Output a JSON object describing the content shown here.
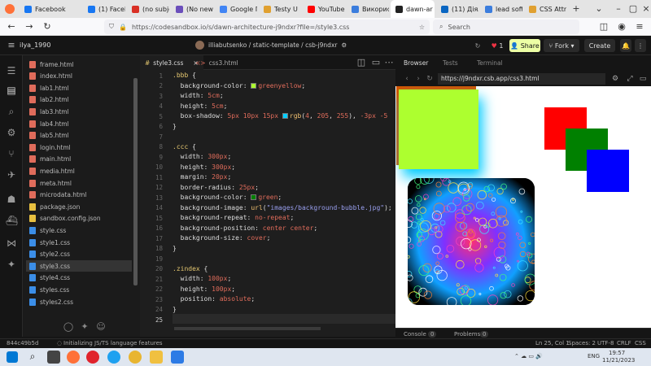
{
  "tabs": [
    {
      "label": "Facebook",
      "color": "#1877f2"
    },
    {
      "label": "(1) Facebo",
      "color": "#1877f2"
    },
    {
      "label": "(no subjec",
      "color": "#d93025"
    },
    {
      "label": "(No new e",
      "color": "#6b4fbb"
    },
    {
      "label": "Google Пе",
      "color": "#4285f4"
    },
    {
      "label": "Testy U",
      "color": "#e0a030"
    },
    {
      "label": "YouTube",
      "color": "#ff0000"
    },
    {
      "label": "Використ",
      "color": "#3b7ddd"
    },
    {
      "label": "dawn-ar",
      "color": "#222222"
    },
    {
      "label": "(11) Діяль",
      "color": "#0a66c2"
    },
    {
      "label": "lead softw",
      "color": "#3b7ddd"
    },
    {
      "label": "CSS Attribu",
      "color": "#e0a030"
    }
  ],
  "nav": {
    "url": "https://codesandbox.io/s/dawn-architecture-j9ndxr?file=/style3.css",
    "search_placeholder": "Search"
  },
  "header": {
    "user": "ilya_1990",
    "project": "illiabutsenko / static-template / csb-j9ndxr",
    "like_count": "1",
    "share": "Share",
    "fork": "Fork",
    "create": "Create"
  },
  "files": [
    "frame.html",
    "index.html",
    "lab1.html",
    "lab2.html",
    "lab3.html",
    "lab4.html",
    "lab5.html",
    "login.html",
    "main.html",
    "media.html",
    "meta.html",
    "microdata.html",
    "package.json",
    "sandbox.config.json",
    "style.css",
    "style1.css",
    "style2.css",
    "style3.css",
    "style4.css",
    "styles.css",
    "styles2.css"
  ],
  "editor": {
    "tab_active": "style3.css",
    "tab_other": "css3.html",
    "line_numbers": [
      "1",
      "2",
      "3",
      "4",
      "5",
      "6",
      "7",
      "8",
      "9",
      "10",
      "11",
      "12",
      "13",
      "14",
      "15",
      "16",
      "17",
      "18",
      "19",
      "20",
      "21",
      "22",
      "23",
      "24",
      "25"
    ]
  },
  "preview": {
    "tab_browser": "Browser",
    "tab_tests": "Tests",
    "tab_terminal": "Terminal",
    "url": "https://j9ndxr.csb.app/css3.html",
    "colors": {
      "greenyellow": "#adff2f",
      "shadow": "#04cdff",
      "red": "#ff0000",
      "green": "#008000",
      "blue": "#0000ff"
    }
  },
  "bottom": {
    "console": "Console",
    "console_count": "0",
    "problems": "Problems",
    "problems_count": "0"
  },
  "status": {
    "hash": "844c49b5d",
    "message": "Initializing JS/TS language features",
    "position": "Ln 25, Col 1",
    "spaces": "Spaces: 2",
    "encoding": "UTF-8",
    "eol": "CRLF",
    "lang": "CSS"
  },
  "clock": {
    "time": "19:57",
    "date": "11/21/2023",
    "lang": "ENG"
  }
}
